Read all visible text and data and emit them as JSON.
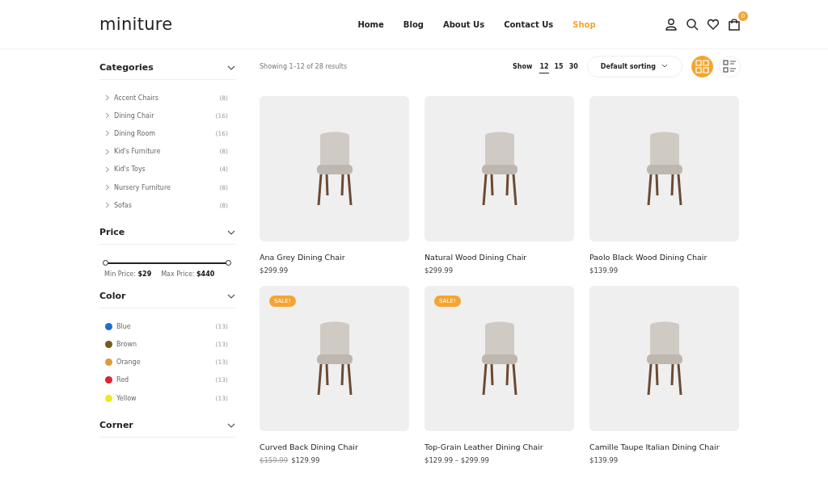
{
  "header": {
    "logo": "miniture",
    "nav": [
      {
        "label": "Home",
        "selected": false
      },
      {
        "label": "Blog",
        "selected": false
      },
      {
        "label": "About Us",
        "selected": false
      },
      {
        "label": "Contact Us",
        "selected": false
      },
      {
        "label": "Shop",
        "selected": true
      }
    ],
    "cart_count": "0"
  },
  "sidebar": {
    "categories": {
      "title": "Categories",
      "items": [
        {
          "label": "Accent Chairs",
          "count": "(8)"
        },
        {
          "label": "Dining Chair",
          "count": "(16)"
        },
        {
          "label": "Dining Room",
          "count": "(16)"
        },
        {
          "label": "Kid's Furniture",
          "count": "(8)"
        },
        {
          "label": "Kid's Toys",
          "count": "(4)"
        },
        {
          "label": "Nursery Furniture",
          "count": "(8)"
        },
        {
          "label": "Sofas",
          "count": "(8)"
        }
      ]
    },
    "price": {
      "title": "Price",
      "level": 1,
      "min_label": "Min Price:",
      "min_value": "$29",
      "max_label": "Max Price:",
      "max_value": "$440"
    },
    "color": {
      "title": "Color",
      "items": [
        {
          "label": "Blue",
          "count": "(13)",
          "color": "#1e6fc9"
        },
        {
          "label": "Brown",
          "count": "(13)",
          "color": "#7a5a1c"
        },
        {
          "label": "Orange",
          "count": "(13)",
          "color": "#e39a36"
        },
        {
          "label": "Red",
          "count": "(13)",
          "color": "#d8262c"
        },
        {
          "label": "Yellow",
          "count": "(13)",
          "color": "#eee826"
        }
      ]
    },
    "corner": {
      "title": "Corner"
    }
  },
  "toolbar": {
    "results": "Showing 1–12 of 28 results",
    "show_label": "Show",
    "per_page": [
      {
        "label": "12",
        "selected": true
      },
      {
        "label": "15",
        "selected": false
      },
      {
        "label": "30",
        "selected": false
      }
    ],
    "sorting": "Default sorting",
    "views": [
      {
        "kind": "grid",
        "selected": true
      },
      {
        "kind": "list",
        "selected": false
      }
    ]
  },
  "products": [
    {
      "name": "Ana Grey Dining Chair",
      "price": "$299.99"
    },
    {
      "name": "Natural Wood Dining Chair",
      "price": "$299.99"
    },
    {
      "name": "Paolo Black Wood Dining Chair",
      "price": "$139.99"
    },
    {
      "name": "Curved Back Dining Chair",
      "badge": "SALE!",
      "old_price": "$159.99",
      "price": "$129.99"
    },
    {
      "name": "Top-Grain Leather Dining Chair",
      "badge": "SALE!",
      "price": "$129.99 – $299.99"
    },
    {
      "name": "Camille Taupe Italian Dining Chair",
      "price": "$139.99"
    }
  ]
}
